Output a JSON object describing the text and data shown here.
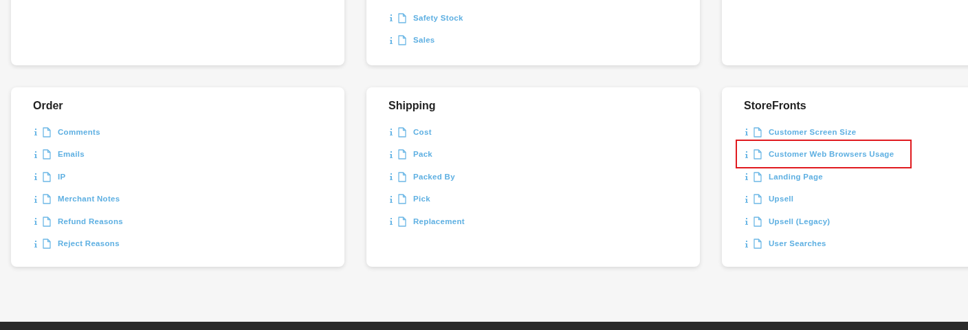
{
  "top_middle_card": {
    "links": [
      {
        "label": "Safety Stock",
        "highlighted": false
      },
      {
        "label": "Sales",
        "highlighted": false
      }
    ]
  },
  "cards": [
    {
      "title": "Order",
      "links": [
        {
          "label": "Comments",
          "highlighted": false
        },
        {
          "label": "Emails",
          "highlighted": false
        },
        {
          "label": "IP",
          "highlighted": false
        },
        {
          "label": "Merchant Notes",
          "highlighted": false
        },
        {
          "label": "Refund Reasons",
          "highlighted": false
        },
        {
          "label": "Reject Reasons",
          "highlighted": false
        }
      ]
    },
    {
      "title": "Shipping",
      "links": [
        {
          "label": "Cost",
          "highlighted": false
        },
        {
          "label": "Pack",
          "highlighted": false
        },
        {
          "label": "Packed By",
          "highlighted": false
        },
        {
          "label": "Pick",
          "highlighted": false
        },
        {
          "label": "Replacement",
          "highlighted": false
        }
      ]
    },
    {
      "title": "StoreFronts",
      "links": [
        {
          "label": "Customer Screen Size",
          "highlighted": false
        },
        {
          "label": "Customer Web Browsers Usage",
          "highlighted": true
        },
        {
          "label": "Landing Page",
          "highlighted": false
        },
        {
          "label": "Upsell",
          "highlighted": false
        },
        {
          "label": "Upsell (Legacy)",
          "highlighted": false
        },
        {
          "label": "User Searches",
          "highlighted": false
        }
      ]
    }
  ]
}
